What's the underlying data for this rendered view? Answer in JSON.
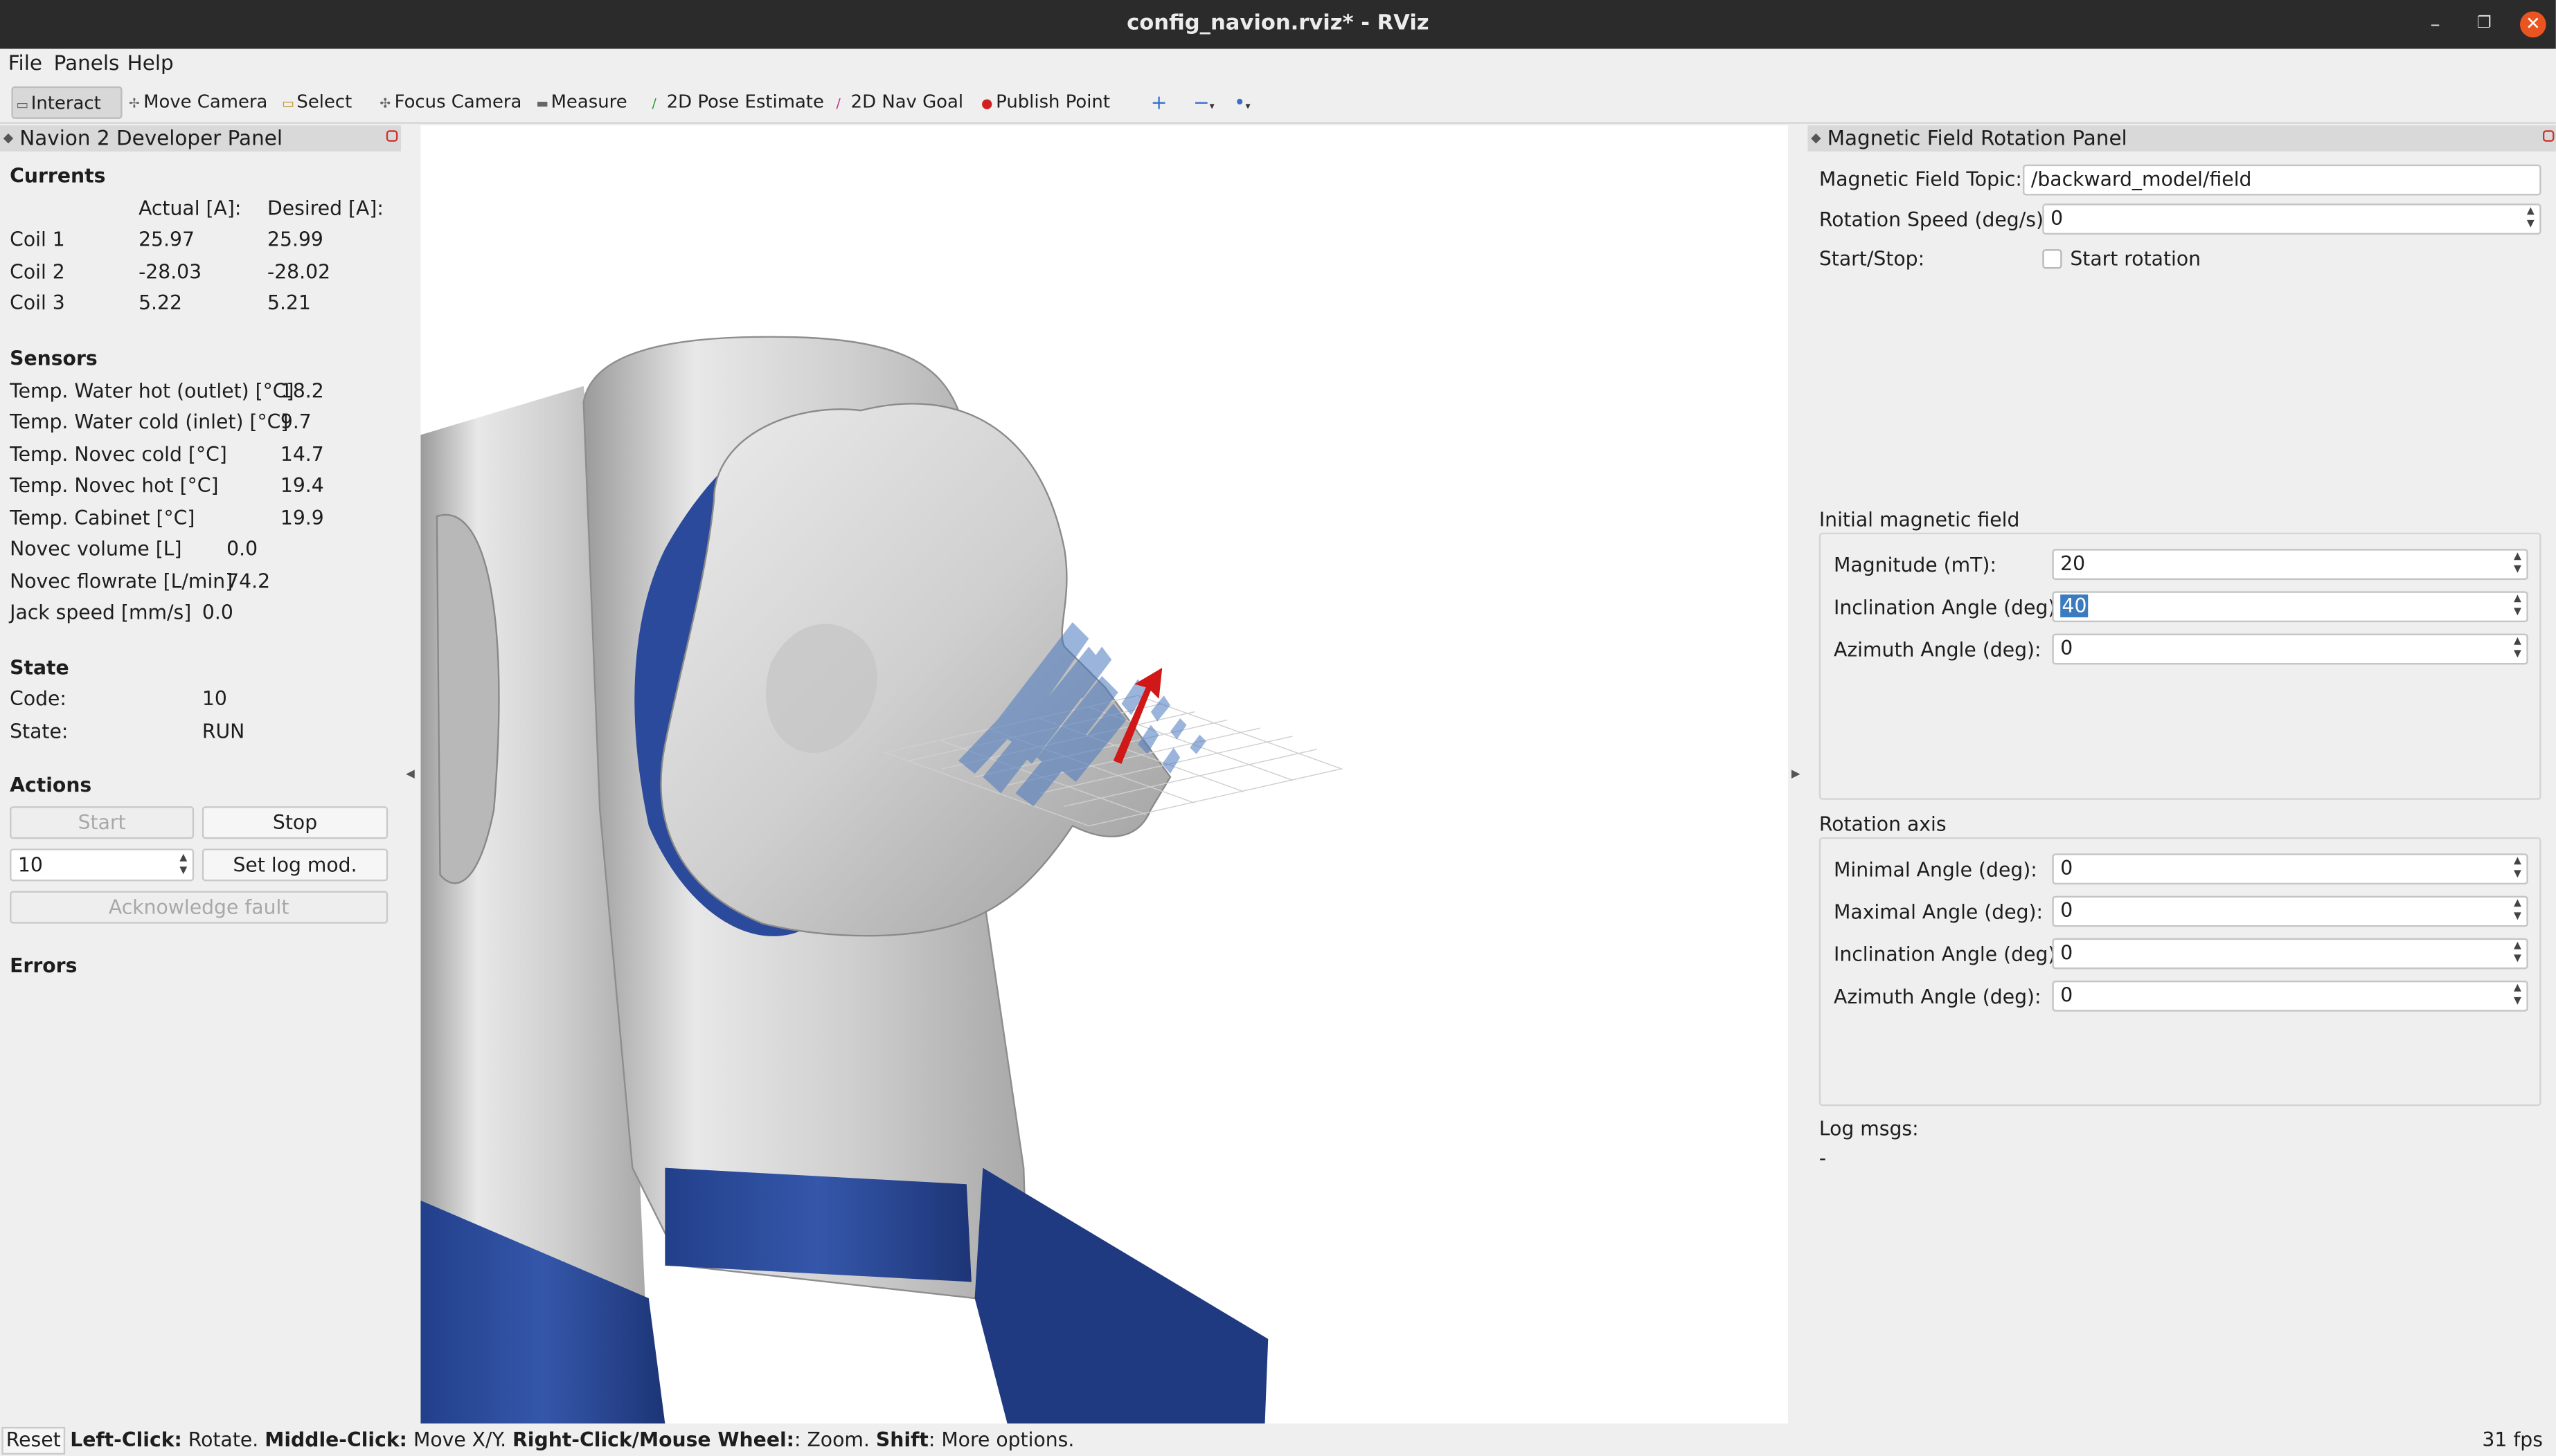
{
  "window": {
    "title": "config_navion.rviz* - RViz",
    "min_glyph": "–",
    "max_glyph": "❐",
    "close_glyph": "✕"
  },
  "menu": [
    "File",
    "Panels",
    "Help"
  ],
  "toolbar": {
    "tools": [
      "Interact",
      "Move Camera",
      "Select",
      "Focus Camera",
      "Measure",
      "2D Pose Estimate",
      "2D Nav Goal",
      "Publish Point"
    ],
    "extra_icons": [
      "plus-icon",
      "minus-icon",
      "dot-icon"
    ]
  },
  "left_panel": {
    "title": "Navion 2 Developer Panel",
    "currents": {
      "heading": "Currents",
      "col_actual": "Actual [A]:",
      "col_desired": "Desired [A]:",
      "rows": [
        {
          "name": "Coil 1",
          "actual": "25.97",
          "desired": "25.99"
        },
        {
          "name": "Coil 2",
          "actual": "-28.03",
          "desired": "-28.02"
        },
        {
          "name": "Coil 3",
          "actual": "5.22",
          "desired": "5.21"
        }
      ]
    },
    "sensors": {
      "heading": "Sensors",
      "rows": [
        {
          "name": "Temp. Water hot (outlet) [°C]",
          "value": "18.2"
        },
        {
          "name": "Temp. Water cold (inlet) [°C]",
          "value": "9.7"
        },
        {
          "name": "Temp. Novec cold [°C]",
          "value": "14.7"
        },
        {
          "name": "Temp. Novec hot [°C]",
          "value": "19.4"
        },
        {
          "name": "Temp. Cabinet [°C]",
          "value": "19.9"
        },
        {
          "name": "Novec volume [L]",
          "value": "0.0"
        },
        {
          "name": "Novec flowrate [L/min]",
          "value": "74.2"
        },
        {
          "name": "Jack speed [mm/s]",
          "value": "0.0"
        }
      ]
    },
    "state": {
      "heading": "State",
      "code_label": "Code:",
      "code_value": "10",
      "state_label": "State:",
      "state_value": "RUN"
    },
    "actions": {
      "heading": "Actions",
      "start": "Start",
      "stop": "Stop",
      "log_value": "10",
      "set_log": "Set log mod.",
      "ack": "Acknowledge fault"
    },
    "errors_heading": "Errors"
  },
  "right_panel": {
    "title": "Magnetic Field Rotation Panel",
    "topic_label": "Magnetic Field Topic:",
    "topic_value": "/backward_model/field",
    "speed_label": "Rotation Speed (deg/s):",
    "speed_value": "0",
    "startstop_label": "Start/Stop:",
    "start_rotation": "Start rotation",
    "start_rotation_checked": false,
    "initial_heading": "Initial magnetic field",
    "magnitude_label": "Magnitude (mT):",
    "magnitude_value": "20",
    "inclination_label": "Inclination Angle (deg):",
    "inclination_value": "40",
    "azimuth_label": "Azimuth Angle (deg):",
    "azimuth_value": "0",
    "rotation_heading": "Rotation axis",
    "min_angle_label": "Minimal Angle (deg):",
    "min_angle_value": "0",
    "max_angle_label": "Maximal Angle (deg):",
    "max_angle_value": "0",
    "rot_incl_label": "Inclination Angle (deg):",
    "rot_incl_value": "0",
    "rot_az_label": "Azimuth Angle (deg):",
    "rot_az_value": "0",
    "log_label": "Log msgs:",
    "log_value": "-"
  },
  "status_bar": {
    "reset": "Reset",
    "k1": "Left-Click:",
    "t1": " Rotate. ",
    "k2": "Middle-Click:",
    "t2": " Move X/Y. ",
    "k3": "Right-Click/Mouse Wheel:",
    "t3": ": Zoom. ",
    "k4": "Shift",
    "t4": ": More options.",
    "fps": "31 fps"
  },
  "colors": {
    "titlebar": "#2b2b2b",
    "close": "#e95420",
    "device_blue": "#2e4e9e",
    "device_gray": "#c8c8c8",
    "selection": "#3b7bbf",
    "arrow_red": "#d01818"
  }
}
